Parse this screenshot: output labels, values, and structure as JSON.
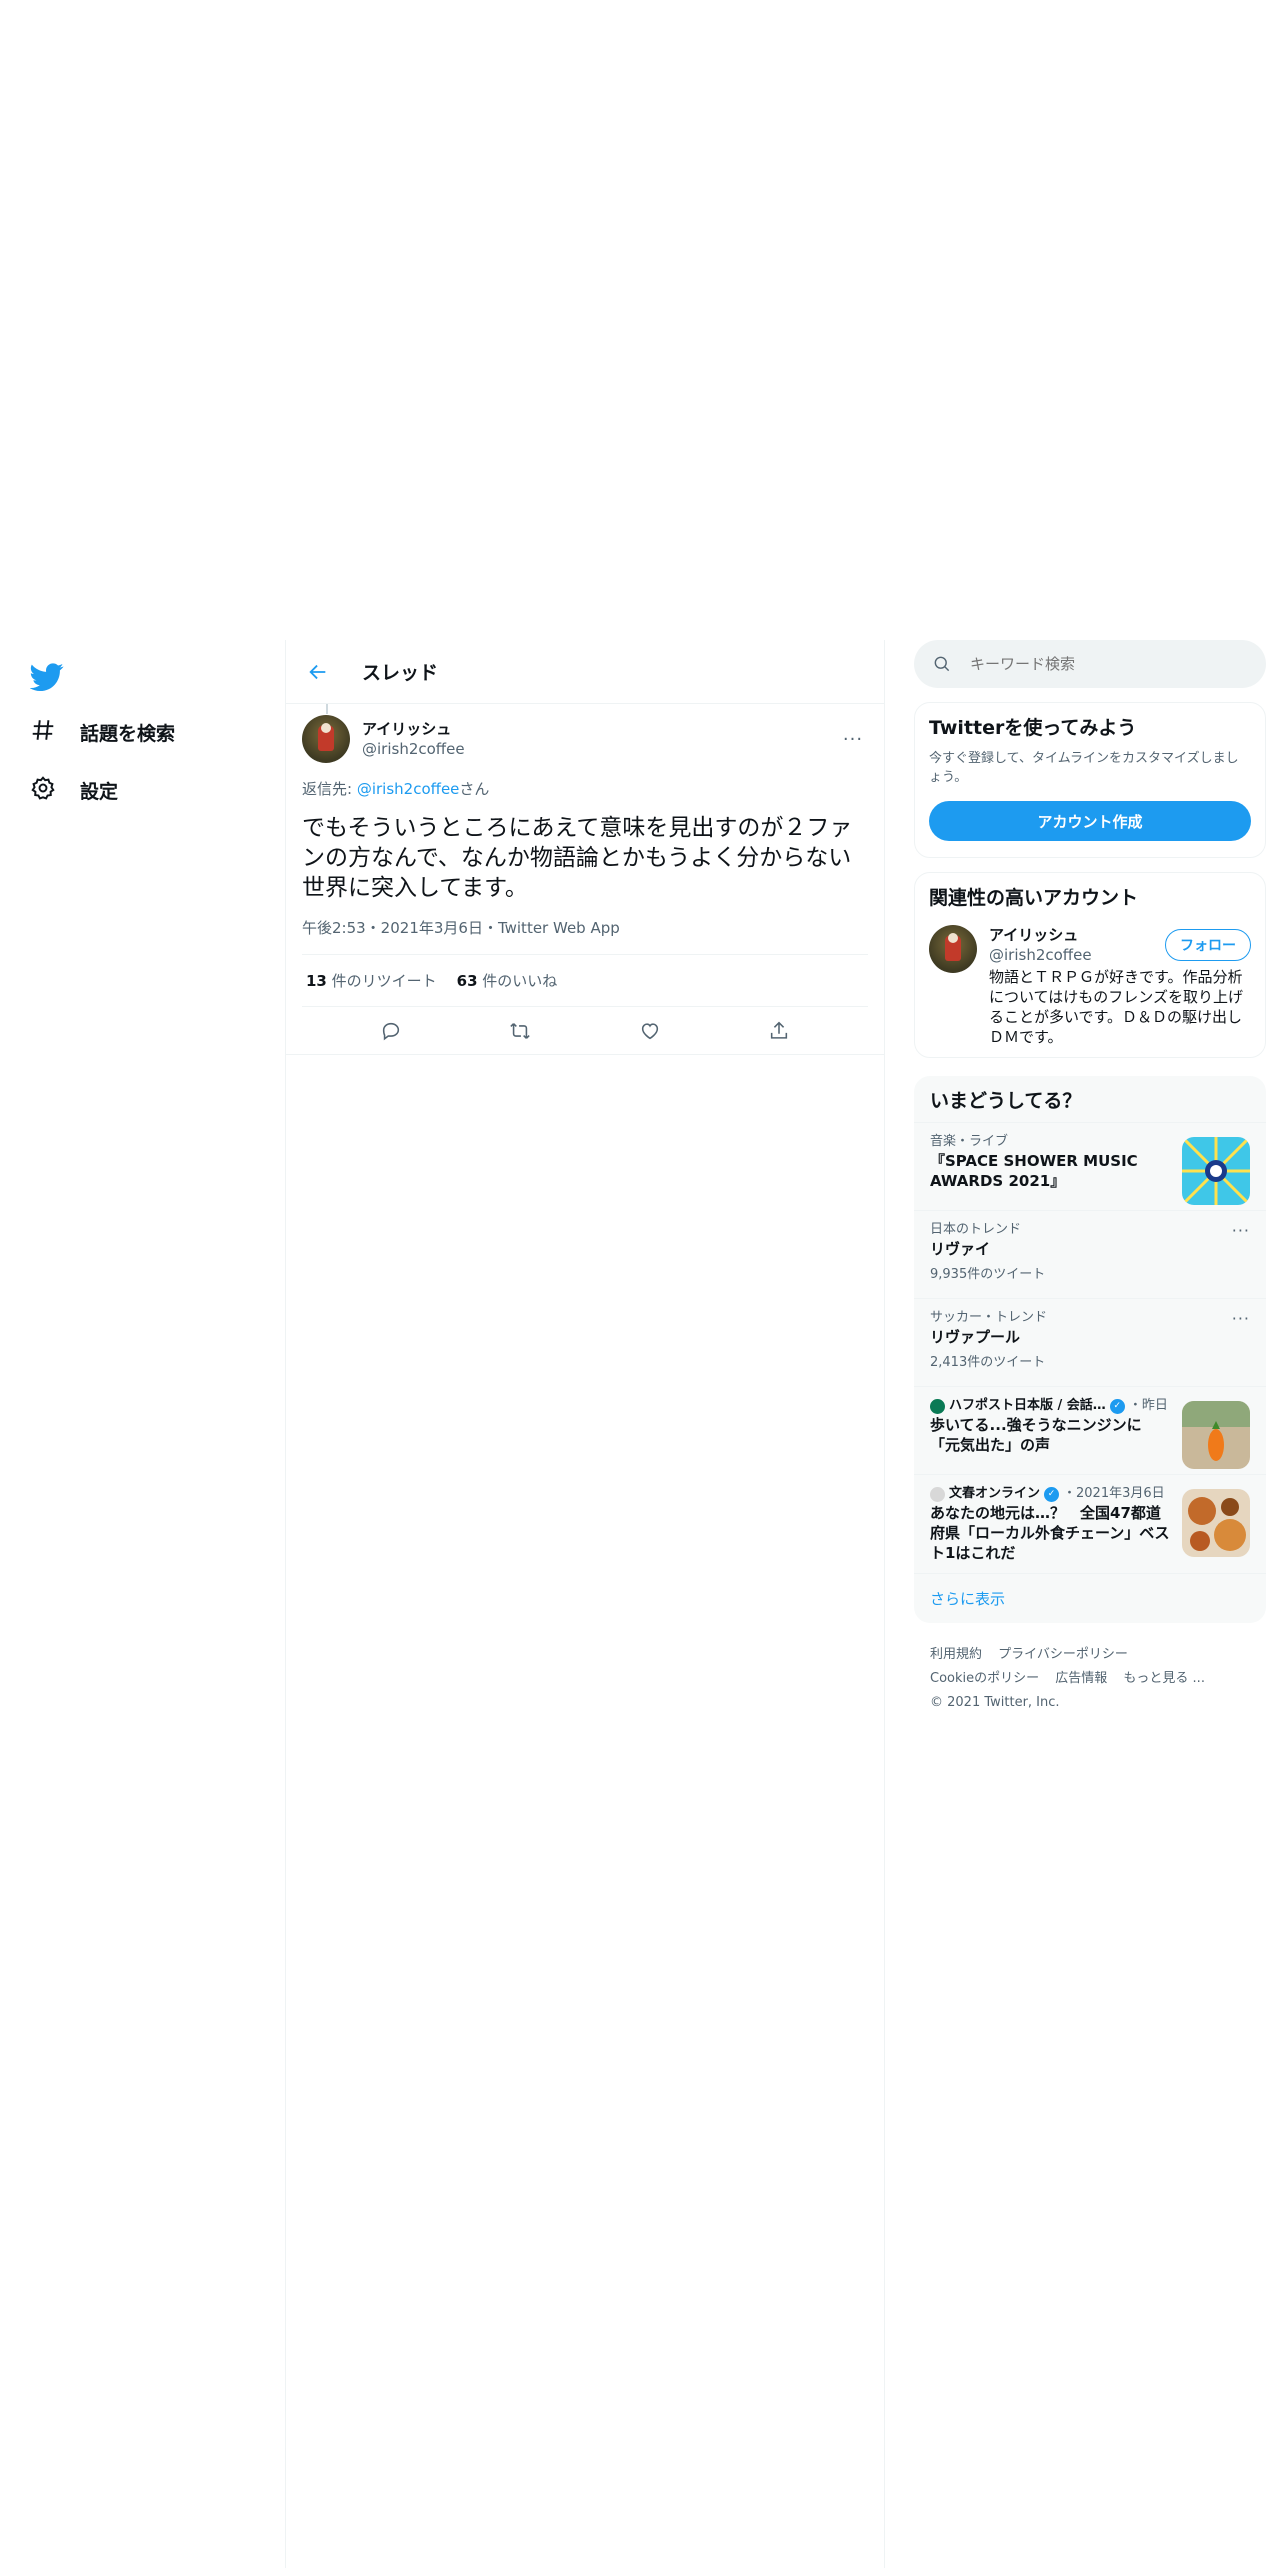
{
  "nav": {
    "explore_label": "話題を検索",
    "settings_label": "設定"
  },
  "header": {
    "title": "スレッド"
  },
  "tweet": {
    "author_name": "アイリッシュ",
    "author_handle": "@irish2coffee",
    "more": "···",
    "reply_prefix": "返信先: ",
    "reply_handle": "@irish2coffee",
    "reply_suffix": "さん",
    "text": "でもそういうところにあえて意味を見出すのが２ファンの方なんで、なんか物語論とかもうよく分からない世界に突入してます。",
    "meta": "午後2:53・2021年3月6日・Twitter Web App",
    "retweets_count": "13",
    "retweets_label": " 件のリツイート",
    "likes_count": "63",
    "likes_label": " 件のいいね"
  },
  "search": {
    "placeholder": "キーワード検索"
  },
  "signup": {
    "title": "Twitterを使ってみよう",
    "desc": "今すぐ登録して、タイムラインをカスタマイズしましょう。",
    "button": "アカウント作成"
  },
  "related": {
    "title": "関連性の高いアカウント",
    "name": "アイリッシュ",
    "handle": "@irish2coffee",
    "follow": "フォロー",
    "bio": "物語とＴＲＰＧが好きです。作品分析についてはけものフレンズを取り上げることが多いです。Ｄ＆Ｄの駆け出しＤＭです。"
  },
  "trends": {
    "title": "いまどうしてる？",
    "items": [
      {
        "context": "音楽・ライブ",
        "title": "『SPACE SHOWER MUSIC AWARDS 2021』"
      },
      {
        "context": "日本のトレンド",
        "title": "リヴァイ",
        "count": "9,935件のツイート"
      },
      {
        "context": "サッカー・トレンド",
        "title": "リヴァプール",
        "count": "2,413件のツイート"
      }
    ],
    "news": [
      {
        "source": "ハフポスト日本版 / 会話…",
        "date": "・昨日",
        "title": "歩いてる...強そうなニンジンに「元気出た」の声"
      },
      {
        "source": "文春オンライン",
        "date": "・2021年3月6日",
        "title": "あなたの地元は…？　全国47都道府県「ローカル外食チェーン」ベスト1はこれだ"
      }
    ],
    "show_more": "さらに表示"
  },
  "footer": {
    "terms": "利用規約",
    "privacy": "プライバシーポリシー",
    "cookie": "Cookieのポリシー",
    "ads": "広告情報",
    "more": "もっと見る ...",
    "copyright": "© 2021 Twitter, Inc."
  },
  "colors": {
    "accent": "#1d9bf0",
    "text": "#0f1419",
    "muted": "#536471"
  }
}
